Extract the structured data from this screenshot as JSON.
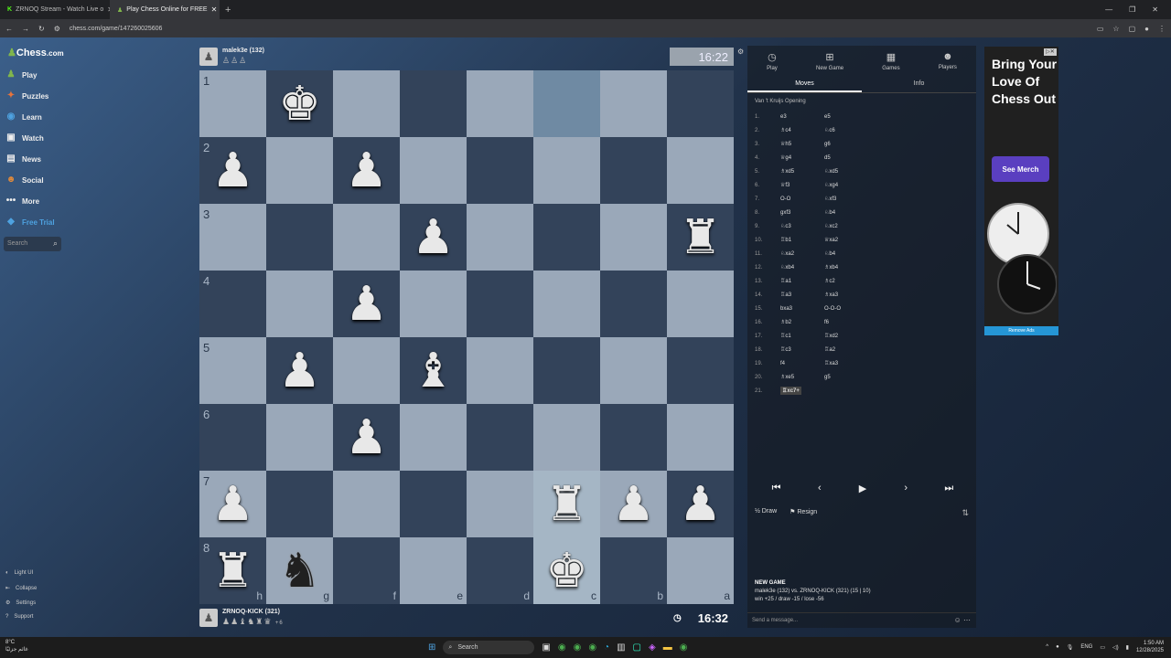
{
  "browser": {
    "tabs": [
      {
        "title": "ZRNOQ Stream - Watch Live o"
      },
      {
        "title": "Play Chess Online for FREE"
      }
    ],
    "url": "chess.com/game/147260025606"
  },
  "sidebar": {
    "logo": "Chess",
    "logo_suffix": ".com",
    "items": [
      {
        "label": "Play"
      },
      {
        "label": "Puzzles"
      },
      {
        "label": "Learn"
      },
      {
        "label": "Watch"
      },
      {
        "label": "News"
      },
      {
        "label": "Social"
      },
      {
        "label": "More"
      },
      {
        "label": "Free Trial"
      }
    ],
    "search_placeholder": "Search",
    "footer": [
      {
        "label": "Light UI"
      },
      {
        "label": "Collapse"
      },
      {
        "label": "Settings"
      },
      {
        "label": "Support"
      }
    ]
  },
  "top_player": {
    "name": "malek3e (132)",
    "clock": "16:22"
  },
  "bottom_player": {
    "name": "ZRNOQ-KICK (321)",
    "material": "+6",
    "clock": "16:32"
  },
  "board": {
    "ranks": [
      "1",
      "2",
      "3",
      "4",
      "5",
      "6",
      "7",
      "8"
    ],
    "files": [
      "h",
      "g",
      "f",
      "e",
      "d",
      "c",
      "b",
      "a"
    ],
    "squares": [
      [
        "",
        "♚",
        "",
        "",
        "",
        "",
        "",
        ""
      ],
      [
        "♟",
        "",
        "♟",
        "",
        "",
        "",
        "",
        ""
      ],
      [
        "",
        "",
        "",
        "♟",
        "",
        "",
        "",
        "♜"
      ],
      [
        "",
        "",
        "♟",
        "",
        "",
        "",
        "",
        ""
      ],
      [
        "",
        "♟",
        "",
        "♝",
        "",
        "",
        "",
        ""
      ],
      [
        "",
        "",
        "♟",
        "",
        "",
        "",
        "",
        ""
      ],
      [
        "♟",
        "",
        "",
        "",
        "",
        "♜",
        "♟",
        "♟"
      ],
      [
        "♜",
        "♞",
        "",
        "",
        "",
        "♚",
        "",
        ""
      ]
    ]
  },
  "panel": {
    "tabs": [
      {
        "label": "Play",
        "icon": "stopwatch-icon"
      },
      {
        "label": "New Game",
        "icon": "plus-icon"
      },
      {
        "label": "Games",
        "icon": "games-icon"
      },
      {
        "label": "Players",
        "icon": "players-icon"
      }
    ],
    "subtabs": [
      "Moves",
      "Info"
    ],
    "opening": "Van 't Kruijs Opening",
    "moves": [
      {
        "n": "1.",
        "w": "e3",
        "b": "e5"
      },
      {
        "n": "2.",
        "w": "♗c4",
        "b": "♘c6"
      },
      {
        "n": "3.",
        "w": "♕h5",
        "b": "g6"
      },
      {
        "n": "4.",
        "w": "♕g4",
        "b": "d5"
      },
      {
        "n": "5.",
        "w": "♗xd5",
        "b": "♘xd5"
      },
      {
        "n": "6.",
        "w": "♕f3",
        "b": "♘xg4"
      },
      {
        "n": "7.",
        "w": "O-O",
        "b": "♘xf3"
      },
      {
        "n": "8.",
        "w": "gxf3",
        "b": "♘b4"
      },
      {
        "n": "9.",
        "w": "♘c3",
        "b": "♘xc2"
      },
      {
        "n": "10.",
        "w": "♖b1",
        "b": "♕xa2"
      },
      {
        "n": "11.",
        "w": "♘xa2",
        "b": "♘b4"
      },
      {
        "n": "12.",
        "w": "♘xb4",
        "b": "♗xb4"
      },
      {
        "n": "13.",
        "w": "♖a1",
        "b": "♗c2"
      },
      {
        "n": "14.",
        "w": "♖a3",
        "b": "♗xa3"
      },
      {
        "n": "15.",
        "w": "bxa3",
        "b": "O-O-O"
      },
      {
        "n": "16.",
        "w": "♗b2",
        "b": "f6"
      },
      {
        "n": "17.",
        "w": "♖c1",
        "b": "♖xd2"
      },
      {
        "n": "18.",
        "w": "♖c3",
        "b": "♖a2"
      },
      {
        "n": "19.",
        "w": "f4",
        "b": "♖xa3"
      },
      {
        "n": "20.",
        "w": "♗xe5",
        "b": "g5"
      },
      {
        "n": "21.",
        "w": "♖xc7+",
        "b": ""
      }
    ],
    "actions": {
      "draw": "Draw",
      "resign": "Resign"
    },
    "new_game_title": "NEW GAME",
    "new_game_line1": "malek3e (132) vs. ZRNOQ-KICK (321) (15 | 10)",
    "new_game_line2": "win +25 / draw -15 / lose -56",
    "chat_placeholder": "Send a message..."
  },
  "ad": {
    "headline": "Bring Your Love Of Chess Out",
    "button": "See Merch",
    "remove": "Remove Ads"
  },
  "taskbar": {
    "weather_temp": "8°C",
    "weather_text": "غائم جزئيًا",
    "search": "Search",
    "lang": "ENG",
    "time": "1:50 AM",
    "date": "12/28/2025"
  }
}
